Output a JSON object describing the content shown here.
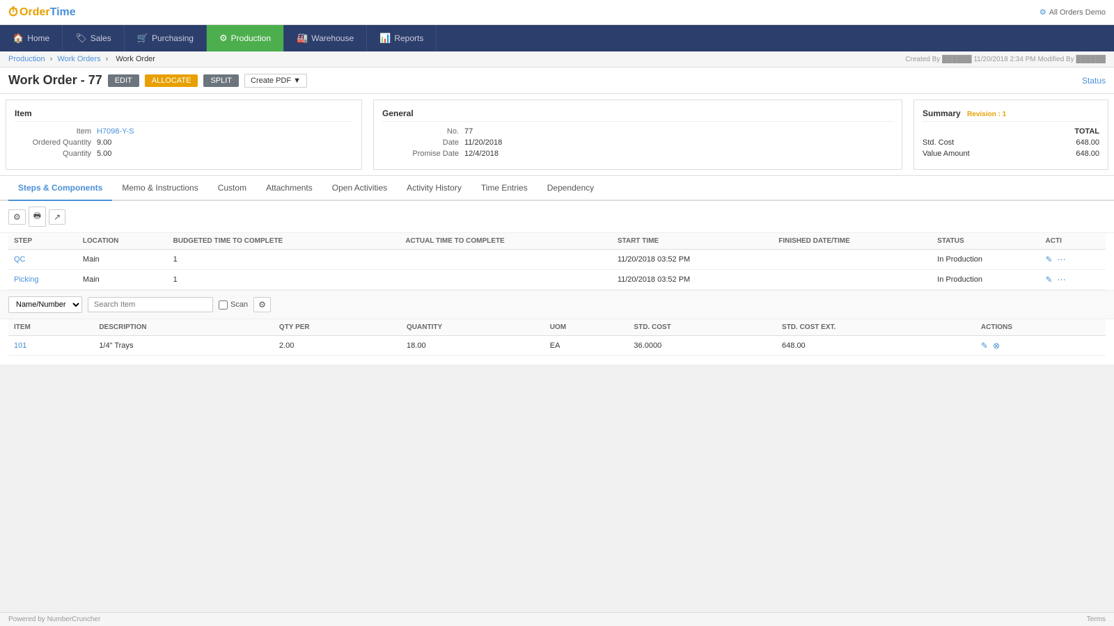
{
  "app": {
    "logo_order": "Order",
    "logo_time": "Time",
    "top_right_label": "All Orders Demo"
  },
  "nav": {
    "items": [
      {
        "id": "home",
        "icon": "🏠",
        "label": "Home",
        "active": false
      },
      {
        "id": "sales",
        "icon": "🏷",
        "label": "Sales",
        "active": false
      },
      {
        "id": "purchasing",
        "icon": "🛒",
        "label": "Purchasing",
        "active": false
      },
      {
        "id": "production",
        "icon": "⚙",
        "label": "Production",
        "active": true
      },
      {
        "id": "warehouse",
        "icon": "🏭",
        "label": "Warehouse",
        "active": false
      },
      {
        "id": "reports",
        "icon": "📊",
        "label": "Reports",
        "active": false
      }
    ]
  },
  "breadcrumb": {
    "items": [
      "Production",
      "Work Orders",
      "Work Order"
    ],
    "created_info": "Created By ██████ 11/20/2018 2:34 PM   Modified By ██████"
  },
  "page_header": {
    "title": "Work Order - 77",
    "btn_edit": "EDIT",
    "btn_allocate": "ALLOCATE",
    "btn_split": "SPLIT",
    "btn_pdf": "Create PDF",
    "status_label": "Status"
  },
  "item_panel": {
    "title": "Item",
    "fields": [
      {
        "label": "Item",
        "value": "H7098-Y-S",
        "link": true
      },
      {
        "label": "Ordered Quantity",
        "value": "9.00",
        "link": false
      },
      {
        "label": "Quantity",
        "value": "5.00",
        "link": false
      }
    ]
  },
  "general_panel": {
    "title": "General",
    "fields": [
      {
        "label": "No.",
        "value": "77"
      },
      {
        "label": "Date",
        "value": "11/20/2018"
      },
      {
        "label": "Promise Date",
        "value": "12/4/2018"
      }
    ]
  },
  "summary_panel": {
    "title": "Summary",
    "revision": "Revision : 1",
    "col_label": "",
    "col_total": "TOTAL",
    "rows": [
      {
        "label": "Std. Cost",
        "value": "648.00"
      },
      {
        "label": "Value Amount",
        "value": "648.00"
      }
    ]
  },
  "tabs": [
    {
      "id": "steps",
      "label": "Steps & Components",
      "active": true
    },
    {
      "id": "memo",
      "label": "Memo & Instructions",
      "active": false
    },
    {
      "id": "custom",
      "label": "Custom",
      "active": false
    },
    {
      "id": "attachments",
      "label": "Attachments",
      "active": false
    },
    {
      "id": "open_activities",
      "label": "Open Activities",
      "active": false
    },
    {
      "id": "activity_history",
      "label": "Activity History",
      "active": false
    },
    {
      "id": "time_entries",
      "label": "Time Entries",
      "active": false
    },
    {
      "id": "dependency",
      "label": "Dependency",
      "active": false
    }
  ],
  "steps_table": {
    "columns": [
      "STEP",
      "LOCATION",
      "BUDGETED TIME TO COMPLETE",
      "ACTUAL TIME TO COMPLETE",
      "START TIME",
      "FINISHED DATE/TIME",
      "STATUS",
      "ACTI"
    ],
    "rows": [
      {
        "step": "QC",
        "location": "Main",
        "budgeted": "1",
        "actual": "",
        "start_time": "11/20/2018 03:52 PM",
        "finished": "",
        "status": "In Production"
      },
      {
        "step": "Picking",
        "location": "Main",
        "budgeted": "1",
        "actual": "",
        "start_time": "11/20/2018 03:52 PM",
        "finished": "",
        "status": "In Production"
      }
    ]
  },
  "search_bar": {
    "select_options": [
      "Name/Number"
    ],
    "select_value": "Name/Number",
    "placeholder": "Search Item",
    "scan_label": "Scan"
  },
  "components_table": {
    "columns": [
      "ITEM",
      "DESCRIPTION",
      "QTY PER",
      "QUANTITY",
      "UOM",
      "STD. COST",
      "STD. COST EXT.",
      "ACTIONS"
    ],
    "rows": [
      {
        "item": "101",
        "description": "1/4\" Trays",
        "qty_per": "2.00",
        "quantity": "18.00",
        "uom": "EA",
        "std_cost": "36.0000",
        "std_cost_ext": "648.00"
      }
    ]
  },
  "footer": {
    "left": "Powered by NumberCruncher",
    "right": "Terms"
  }
}
